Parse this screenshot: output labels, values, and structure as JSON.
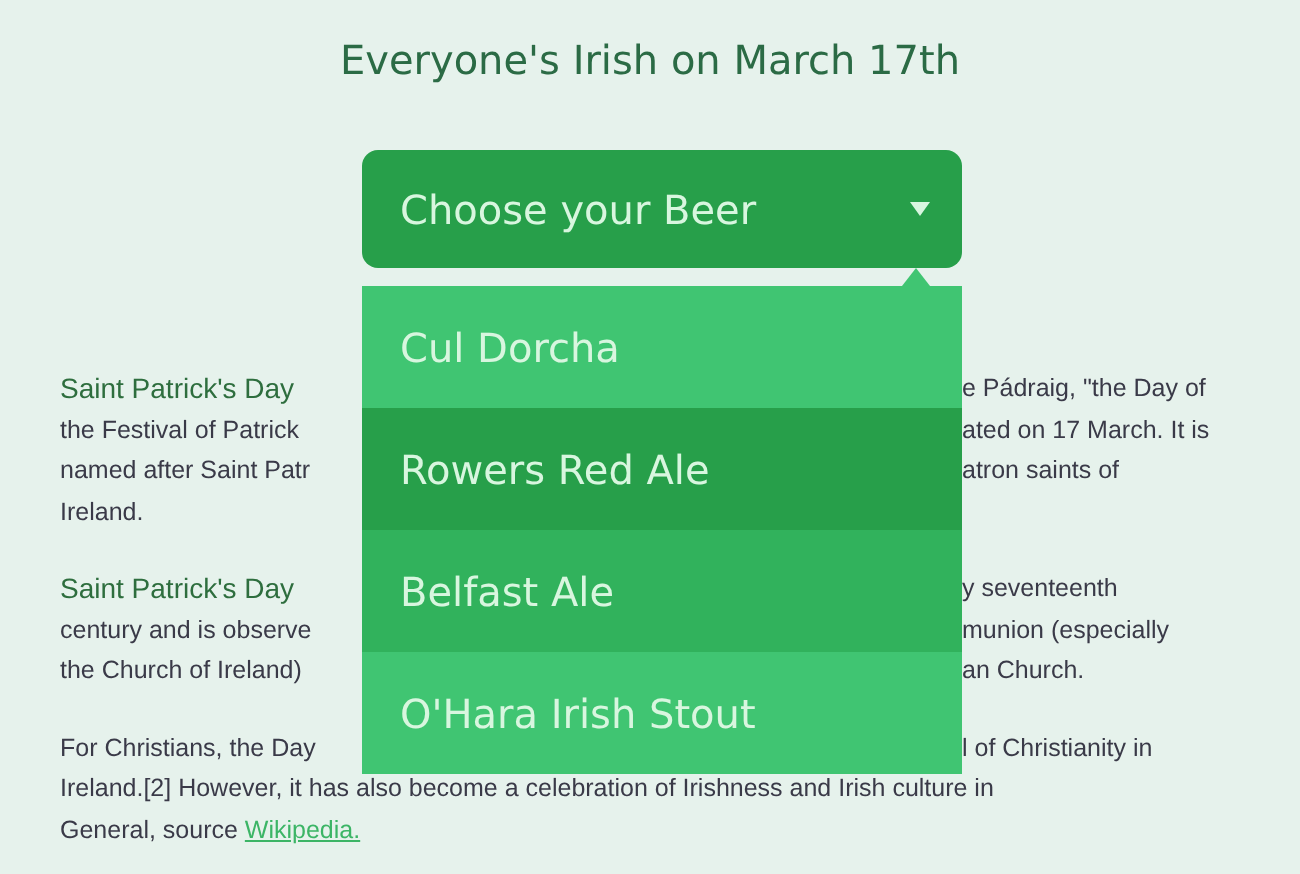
{
  "title": "Everyone's Irish on March 17th",
  "dropdown": {
    "label": "Choose your Beer",
    "options": [
      {
        "label": "Cul Dorcha",
        "color": "#40c572"
      },
      {
        "label": "Rowers Red Ale",
        "color": "#279f4a"
      },
      {
        "label": "Belfast Ale",
        "color": "#31b25c"
      },
      {
        "label": "O'Hara Irish Stout",
        "color": "#40c572"
      }
    ]
  },
  "article": {
    "paragraphs": [
      {
        "lines": [
          {
            "lead": "Saint Patrick's Day",
            "right": "e Pádraig, \"the Day of"
          },
          {
            "left": "the Festival of Patrick",
            "right": "ated on 17 March. It is"
          },
          {
            "left": "named after Saint Patr",
            "right": "atron saints of"
          },
          {
            "left": "Ireland."
          }
        ]
      },
      {
        "lines": [
          {
            "lead": "Saint Patrick's Day",
            "right": "y seventeenth"
          },
          {
            "left": "century and is observe",
            "right": "munion (especially"
          },
          {
            "left": "the Church of Ireland)",
            "right": "an Church."
          }
        ]
      },
      {
        "lines": [
          {
            "left": "For Christians, the Day",
            "right": "l of Christianity in"
          },
          {
            "left": "Ireland.[2] However, it has also become a celebration of Irishness and Irish culture in"
          },
          {
            "left": "General, source ",
            "link": "Wikipedia."
          }
        ]
      }
    ]
  }
}
